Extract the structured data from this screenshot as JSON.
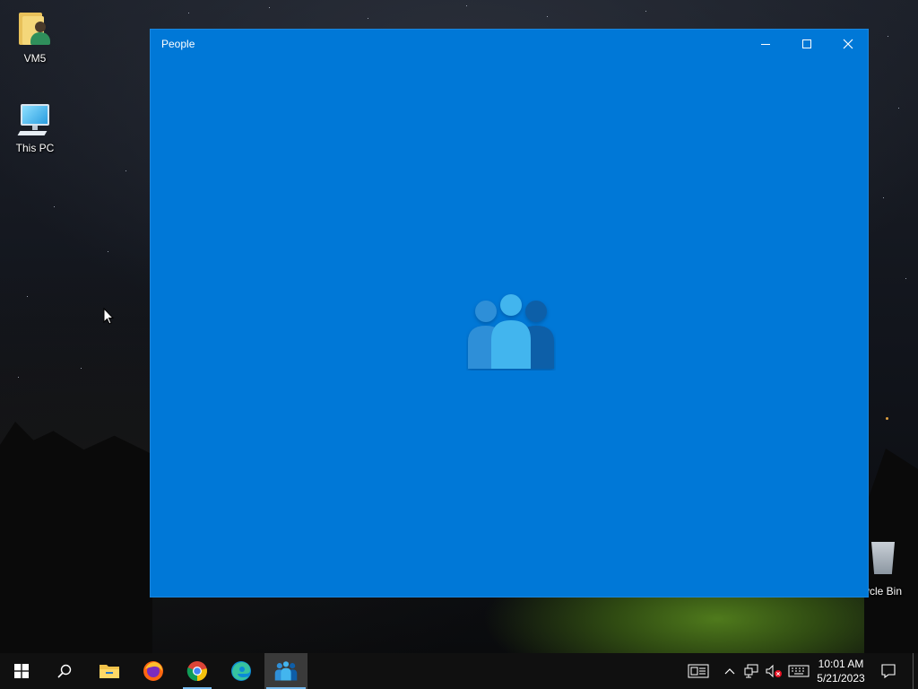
{
  "desktop": {
    "icons": [
      {
        "label": "VM5",
        "icon": "user-folder-icon"
      },
      {
        "label": "This PC",
        "icon": "computer-icon"
      },
      {
        "label": "ycle Bin",
        "icon": "recycle-bin-icon"
      }
    ]
  },
  "window": {
    "title": "People",
    "background_color": "#0078d7",
    "controls": [
      "minimize-icon",
      "maximize-icon",
      "close-icon"
    ],
    "splash_icon": "people-app-icon"
  },
  "taskbar": {
    "buttons": [
      {
        "name": "start",
        "icon": "windows-logo-icon"
      },
      {
        "name": "search",
        "icon": "search-icon"
      },
      {
        "name": "file-explorer",
        "icon": "folder-icon"
      },
      {
        "name": "firefox",
        "icon": "firefox-icon"
      },
      {
        "name": "chrome",
        "icon": "chrome-icon"
      },
      {
        "name": "edge",
        "icon": "edge-icon"
      },
      {
        "name": "people",
        "icon": "people-icon"
      }
    ],
    "tray": [
      "news-icon",
      "chevron-up-icon",
      "network-icon",
      "volume-muted-icon",
      "keyboard-icon"
    ],
    "time": "10:01 AM",
    "date": "5/21/2023",
    "notification_icon": "notification-icon"
  }
}
